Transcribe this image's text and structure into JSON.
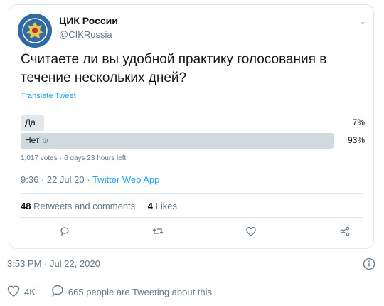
{
  "account": {
    "name": "ЦИК России",
    "handle": "@CIKRussia"
  },
  "tweet": {
    "text": "Считаете ли вы удобной практику голосования в течение нескольких дней?",
    "translate": "Translate Tweet"
  },
  "poll": {
    "options": [
      {
        "label": "Да",
        "percent_text": "7%",
        "percent": 7
      },
      {
        "label": "Нет",
        "percent_text": "93%",
        "percent": 93
      }
    ],
    "votes": "1,017 votes",
    "time_left": "6 days 23 hours left"
  },
  "meta": {
    "time": "9:36 · 22 Jul 20 ·",
    "app": "Twitter Web App"
  },
  "stats": {
    "retweets_count": "48",
    "retweets_label": "Retweets and comments",
    "likes_count": "4",
    "likes_label": "Likes"
  },
  "footer": {
    "timestamp": "3:53 PM · Jul 22, 2020"
  },
  "bottom": {
    "likes": "4K",
    "tweeting": "665 people are Tweeting about this"
  },
  "colors": {
    "accent": "#1da1f2",
    "muted": "#657786",
    "border": "#e1e8ed"
  }
}
